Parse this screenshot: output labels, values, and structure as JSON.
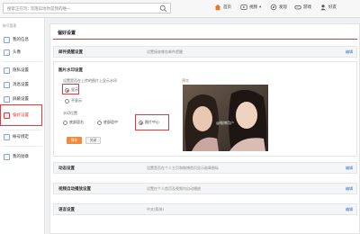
{
  "search": {
    "placeholder": "搜索正在玩: 流落异地你是我的唯一"
  },
  "nav": {
    "home": "首页",
    "video": "视频",
    "discover": "发现",
    "game": "游戏",
    "user": "好友"
  },
  "sidebar": {
    "section": "帐号管理",
    "items": [
      {
        "label": "我的信息"
      },
      {
        "label": "头像"
      },
      {
        "label": "隐私设置"
      },
      {
        "label": "消息设置"
      },
      {
        "label": "屏蔽设置"
      },
      {
        "label": "偏好设置"
      },
      {
        "label": "帐号绑定"
      },
      {
        "label": "我的勋章"
      }
    ]
  },
  "main": {
    "title": "偏好设置",
    "rows": [
      {
        "label": "邮件提醒设置",
        "desc": "设置接收哪些邮件提醒",
        "edit": "编辑"
      },
      {
        "label": "动态设置",
        "desc": "设置是否在个人主页和微博首页显示勋章图标",
        "edit": "编辑"
      },
      {
        "label": "视频自动播放设置",
        "desc": "设置在个人首页及视频内自动播放",
        "edit": "编辑"
      },
      {
        "label": "语言设置",
        "desc": "中文(简体)",
        "edit": "编辑"
      }
    ],
    "watermark": {
      "label": "图片水印设置",
      "question": "设置是否在上传的图片上显示水印",
      "show": "显示",
      "hide": "不显示",
      "position_label": "水印位置",
      "pos_bottom_right": "底部居右",
      "pos_bottom_center": "底部居中",
      "pos_center": "图片中心",
      "save": "保存",
      "close": "关闭",
      "preview_label": "预览",
      "watermark_text": "@微博用户"
    }
  },
  "colors": {
    "accent": "#e4393c",
    "save_button": "#f08a3c",
    "link": "#2f6db6"
  }
}
